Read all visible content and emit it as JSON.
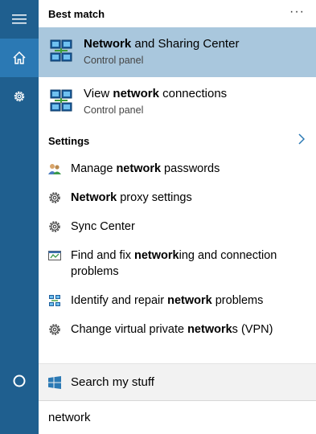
{
  "sidebar": {
    "items": [
      {
        "name": "menu-icon"
      },
      {
        "name": "home-icon"
      },
      {
        "name": "gear-icon"
      },
      {
        "name": "cortana-circle-icon"
      }
    ]
  },
  "best_match": {
    "header": "Best match",
    "more": "···"
  },
  "results": [
    {
      "pre": "",
      "bold": "Network",
      "post": " and Sharing Center",
      "sub": "Control panel",
      "icon": "network-monitors-icon"
    },
    {
      "pre": "View ",
      "bold": "network",
      "post": " connections",
      "sub": "Control panel",
      "icon": "network-monitors-icon"
    }
  ],
  "settings": {
    "header": "Settings",
    "items": [
      {
        "pre": "Manage ",
        "bold": "network",
        "post": " passwords",
        "icon": "users-icon"
      },
      {
        "pre": "",
        "bold": "Network",
        "post": " proxy settings",
        "icon": "gear-icon"
      },
      {
        "pre": "Sync Center",
        "bold": "",
        "post": "",
        "icon": "gear-icon"
      },
      {
        "pre": "Find and fix ",
        "bold": "network",
        "post": "ing and connection problems",
        "icon": "troubleshoot-icon"
      },
      {
        "pre": "Identify and repair ",
        "bold": "network",
        "post": " problems",
        "icon": "network-monitors-icon"
      },
      {
        "pre": "Change virtual private ",
        "bold": "network",
        "post": "s (VPN)",
        "icon": "gear-icon"
      }
    ]
  },
  "search_my_stuff": {
    "label": "Search my stuff",
    "icon": "windows-logo-icon"
  },
  "search": {
    "value": "network"
  },
  "colors": {
    "sidebar": "#1f5f8f",
    "sidebar_active": "#2b79b4",
    "selected": "#a9c7dd"
  }
}
